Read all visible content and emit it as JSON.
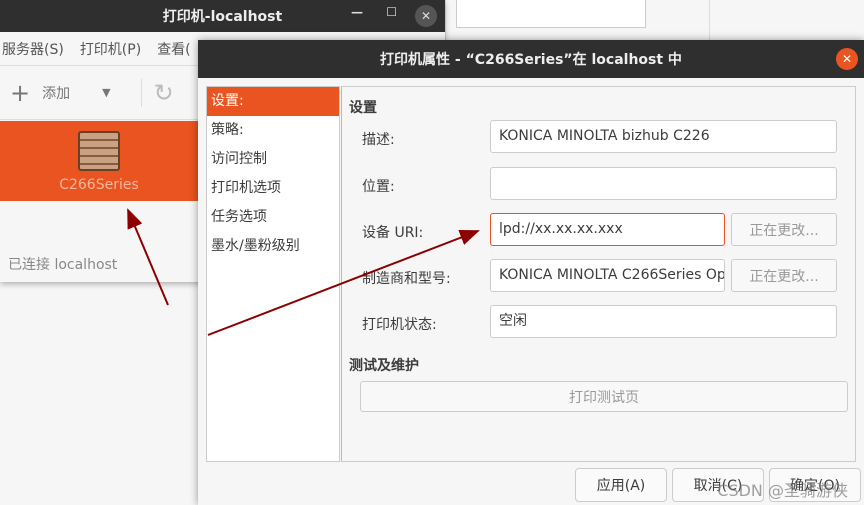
{
  "main_window": {
    "title": "打印机-localhost",
    "menu": [
      "服务器(S)",
      "打印机(P)",
      "查看("
    ],
    "add_label": "添加",
    "printer_name": "C266Series",
    "status": "已连接 localhost"
  },
  "dialog": {
    "title": "打印机属性 - “C266Series”在 localhost 中",
    "sidebar": [
      "设置:",
      "策略:",
      "访问控制",
      "打印机选项",
      "任务选项",
      "墨水/墨粉级别"
    ],
    "section_settings": "设置",
    "fields": [
      {
        "label": "描述:",
        "value": "KONICA MINOLTA bizhub C226"
      },
      {
        "label": "位置:",
        "value": ""
      },
      {
        "label": "设备 URI:",
        "value": "lpd://xx.xx.xx.xxx",
        "button": "正在更改..."
      },
      {
        "label": "制造商和型号:",
        "value": "KONICA MINOLTA C266Series Op",
        "button": "正在更改..."
      },
      {
        "label": "打印机状态:",
        "value": "空闲"
      }
    ],
    "section_test": "测试及维护",
    "test_button": "打印测试页",
    "apply": "应用(A)",
    "cancel": "取消(C)",
    "ok": "确定(O)"
  },
  "watermark": "CSDN @圣骑游侠",
  "colors": {
    "accent": "#e95420",
    "arrow": "#8b0000"
  }
}
